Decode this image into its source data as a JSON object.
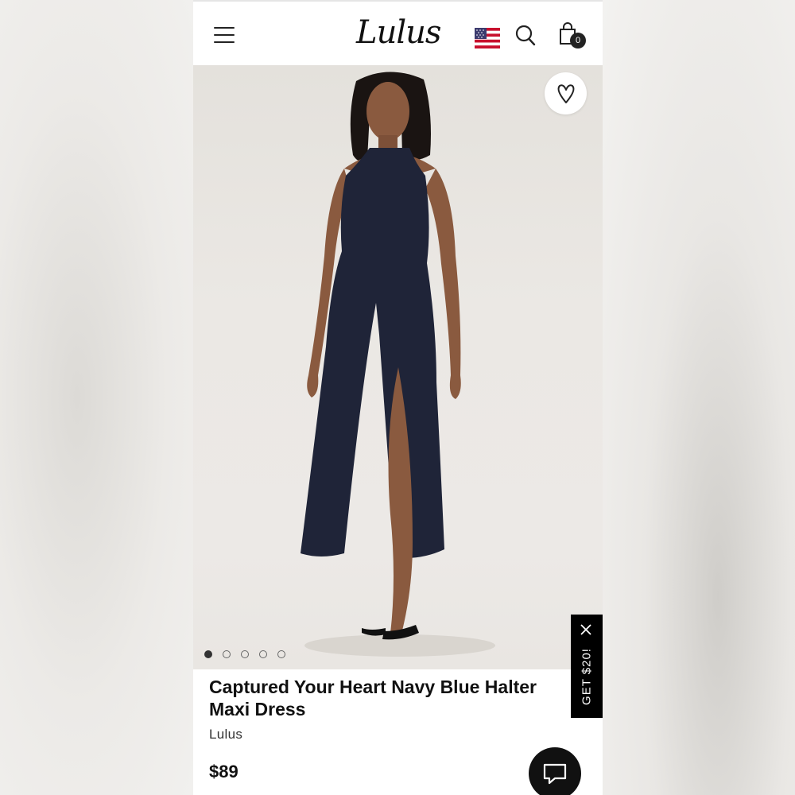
{
  "header": {
    "logo_text": "Lulus",
    "menu_icon": "hamburger-menu-icon",
    "country_icon": "us-flag-icon",
    "search_icon": "search-icon",
    "bag_icon": "shopping-bag-icon",
    "bag_count": "0"
  },
  "gallery": {
    "wishlist_icon": "heart-icon",
    "image_count": 5,
    "active_index": 0
  },
  "promo": {
    "label": "GET $20!",
    "close_icon": "close-icon"
  },
  "product": {
    "title": "Captured Your Heart Navy Blue Halter Maxi Dress",
    "brand": "Lulus",
    "price": "$89"
  },
  "chat": {
    "icon": "chat-bubble-icon"
  },
  "colors": {
    "dress": "#1f2438",
    "brand_black": "#111111"
  }
}
